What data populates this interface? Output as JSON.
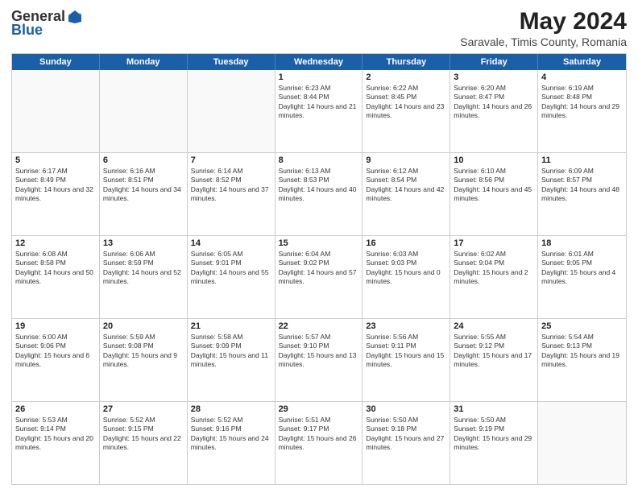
{
  "header": {
    "logo_general": "General",
    "logo_blue": "Blue",
    "main_title": "May 2024",
    "subtitle": "Saravale, Timis County, Romania"
  },
  "calendar": {
    "weekdays": [
      "Sunday",
      "Monday",
      "Tuesday",
      "Wednesday",
      "Thursday",
      "Friday",
      "Saturday"
    ],
    "rows": [
      [
        {
          "day": "",
          "empty": true
        },
        {
          "day": "",
          "empty": true
        },
        {
          "day": "",
          "empty": true
        },
        {
          "day": "1",
          "sunrise": "6:23 AM",
          "sunset": "8:44 PM",
          "daylight": "14 hours and 21 minutes."
        },
        {
          "day": "2",
          "sunrise": "6:22 AM",
          "sunset": "8:45 PM",
          "daylight": "14 hours and 23 minutes."
        },
        {
          "day": "3",
          "sunrise": "6:20 AM",
          "sunset": "8:47 PM",
          "daylight": "14 hours and 26 minutes."
        },
        {
          "day": "4",
          "sunrise": "6:19 AM",
          "sunset": "8:48 PM",
          "daylight": "14 hours and 29 minutes."
        }
      ],
      [
        {
          "day": "5",
          "sunrise": "6:17 AM",
          "sunset": "8:49 PM",
          "daylight": "14 hours and 32 minutes."
        },
        {
          "day": "6",
          "sunrise": "6:16 AM",
          "sunset": "8:51 PM",
          "daylight": "14 hours and 34 minutes."
        },
        {
          "day": "7",
          "sunrise": "6:14 AM",
          "sunset": "8:52 PM",
          "daylight": "14 hours and 37 minutes."
        },
        {
          "day": "8",
          "sunrise": "6:13 AM",
          "sunset": "8:53 PM",
          "daylight": "14 hours and 40 minutes."
        },
        {
          "day": "9",
          "sunrise": "6:12 AM",
          "sunset": "8:54 PM",
          "daylight": "14 hours and 42 minutes."
        },
        {
          "day": "10",
          "sunrise": "6:10 AM",
          "sunset": "8:56 PM",
          "daylight": "14 hours and 45 minutes."
        },
        {
          "day": "11",
          "sunrise": "6:09 AM",
          "sunset": "8:57 PM",
          "daylight": "14 hours and 48 minutes."
        }
      ],
      [
        {
          "day": "12",
          "sunrise": "6:08 AM",
          "sunset": "8:58 PM",
          "daylight": "14 hours and 50 minutes."
        },
        {
          "day": "13",
          "sunrise": "6:06 AM",
          "sunset": "8:59 PM",
          "daylight": "14 hours and 52 minutes."
        },
        {
          "day": "14",
          "sunrise": "6:05 AM",
          "sunset": "9:01 PM",
          "daylight": "14 hours and 55 minutes."
        },
        {
          "day": "15",
          "sunrise": "6:04 AM",
          "sunset": "9:02 PM",
          "daylight": "14 hours and 57 minutes."
        },
        {
          "day": "16",
          "sunrise": "6:03 AM",
          "sunset": "9:03 PM",
          "daylight": "15 hours and 0 minutes."
        },
        {
          "day": "17",
          "sunrise": "6:02 AM",
          "sunset": "9:04 PM",
          "daylight": "15 hours and 2 minutes."
        },
        {
          "day": "18",
          "sunrise": "6:01 AM",
          "sunset": "9:05 PM",
          "daylight": "15 hours and 4 minutes."
        }
      ],
      [
        {
          "day": "19",
          "sunrise": "6:00 AM",
          "sunset": "9:06 PM",
          "daylight": "15 hours and 6 minutes."
        },
        {
          "day": "20",
          "sunrise": "5:59 AM",
          "sunset": "9:08 PM",
          "daylight": "15 hours and 9 minutes."
        },
        {
          "day": "21",
          "sunrise": "5:58 AM",
          "sunset": "9:09 PM",
          "daylight": "15 hours and 11 minutes."
        },
        {
          "day": "22",
          "sunrise": "5:57 AM",
          "sunset": "9:10 PM",
          "daylight": "15 hours and 13 minutes."
        },
        {
          "day": "23",
          "sunrise": "5:56 AM",
          "sunset": "9:11 PM",
          "daylight": "15 hours and 15 minutes."
        },
        {
          "day": "24",
          "sunrise": "5:55 AM",
          "sunset": "9:12 PM",
          "daylight": "15 hours and 17 minutes."
        },
        {
          "day": "25",
          "sunrise": "5:54 AM",
          "sunset": "9:13 PM",
          "daylight": "15 hours and 19 minutes."
        }
      ],
      [
        {
          "day": "26",
          "sunrise": "5:53 AM",
          "sunset": "9:14 PM",
          "daylight": "15 hours and 20 minutes."
        },
        {
          "day": "27",
          "sunrise": "5:52 AM",
          "sunset": "9:15 PM",
          "daylight": "15 hours and 22 minutes."
        },
        {
          "day": "28",
          "sunrise": "5:52 AM",
          "sunset": "9:16 PM",
          "daylight": "15 hours and 24 minutes."
        },
        {
          "day": "29",
          "sunrise": "5:51 AM",
          "sunset": "9:17 PM",
          "daylight": "15 hours and 26 minutes."
        },
        {
          "day": "30",
          "sunrise": "5:50 AM",
          "sunset": "9:18 PM",
          "daylight": "15 hours and 27 minutes."
        },
        {
          "day": "31",
          "sunrise": "5:50 AM",
          "sunset": "9:19 PM",
          "daylight": "15 hours and 29 minutes."
        },
        {
          "day": "",
          "empty": true
        }
      ]
    ]
  }
}
